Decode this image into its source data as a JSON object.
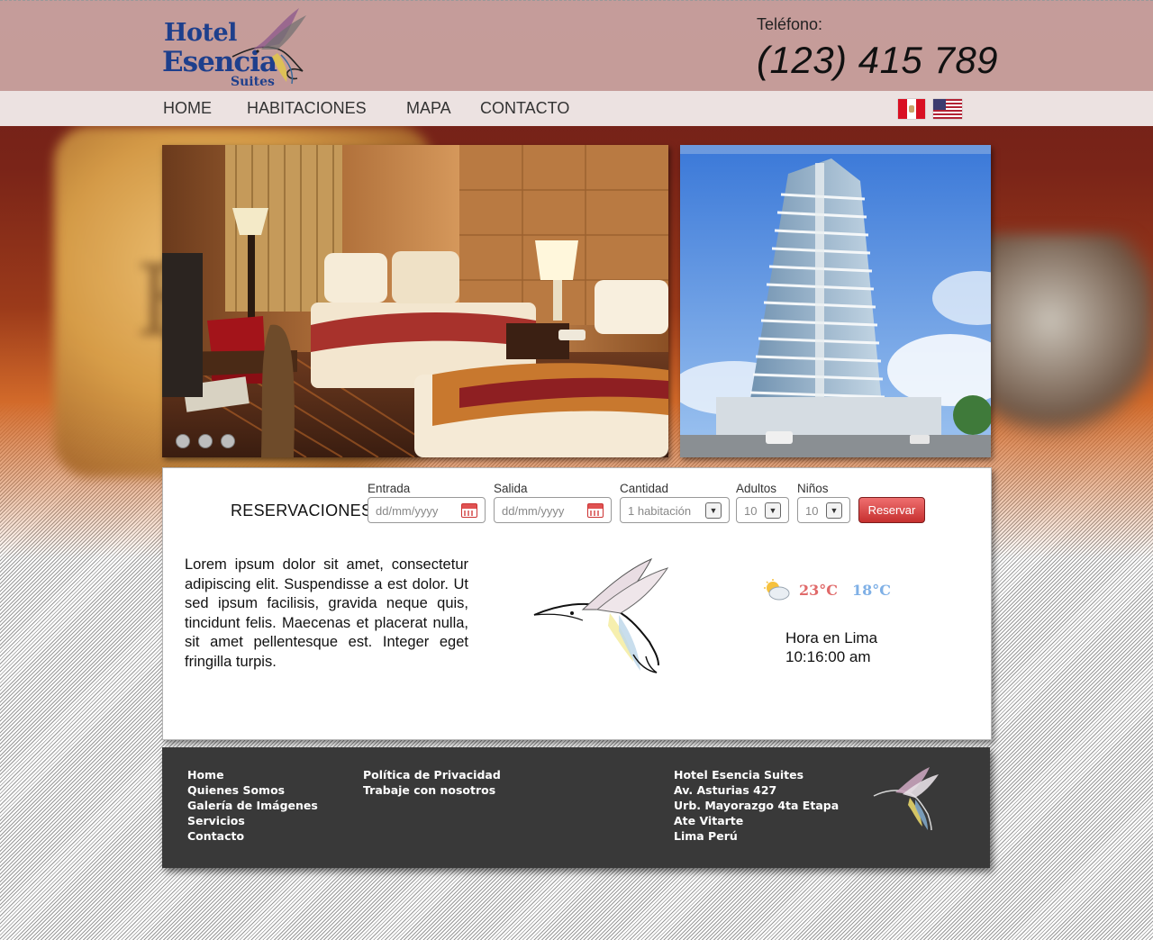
{
  "header": {
    "logo": {
      "line1": "Hotel",
      "line2": "Esencia",
      "line3": "Suites"
    },
    "phone_label": "Teléfono:",
    "phone_number": "(123) 415 789"
  },
  "nav": {
    "items": [
      "HOME",
      "HABITACIONES",
      "MAPA",
      "CONTACTO"
    ],
    "flags": [
      "peru-flag-icon",
      "usa-flag-icon"
    ]
  },
  "gallery": {
    "images": [
      "hotel-room-photo",
      "hotel-building-photo"
    ],
    "dots": 3
  },
  "reservation": {
    "title": "RESERVACIONES",
    "entrada": {
      "label": "Entrada",
      "placeholder": "dd/mm/yyyy"
    },
    "salida": {
      "label": "Salida",
      "placeholder": "dd/mm/yyyy"
    },
    "cantidad": {
      "label": "Cantidad",
      "value": "1 habitación"
    },
    "adultos": {
      "label": "Adultos",
      "value": "10"
    },
    "ninos": {
      "label": "Niños",
      "value": "10"
    },
    "submit": "Reservar"
  },
  "content": {
    "lorem": "Lorem ipsum dolor sit amet, consectetur adipiscing elit. Suspendisse a est dolor. Ut sed ipsum facilisis, gravida neque quis, tincidunt felis. Maecenas et placerat nulla, sit amet pellentesque est. Integer eget fringilla turpis.",
    "weather": {
      "icon": "partly-cloudy-icon",
      "high": "23°C",
      "low": "18°C"
    },
    "clock": {
      "label": "Hora en Lima",
      "time": "10:16:00 am"
    }
  },
  "footer": {
    "col1": [
      "Home",
      "Quienes Somos",
      "Galería de Imágenes",
      "Servicios",
      "Contacto"
    ],
    "col2": [
      "Política de Privacidad",
      "Trabaje con nosotros"
    ],
    "address": [
      "Hotel Esencia Suites",
      "Av. Asturias 427",
      "Urb. Mayorazgo 4ta Etapa",
      "Ate Vitarte",
      "Lima Perú"
    ]
  },
  "colors": {
    "header_bg": "#cba6a4",
    "nav_bg": "#ece2e1",
    "logo_blue": "#1e3f8c",
    "button_red": "#c6302f",
    "footer_bg": "#393939",
    "temp_high": "#e06a6a",
    "temp_low": "#7fb0e6"
  }
}
